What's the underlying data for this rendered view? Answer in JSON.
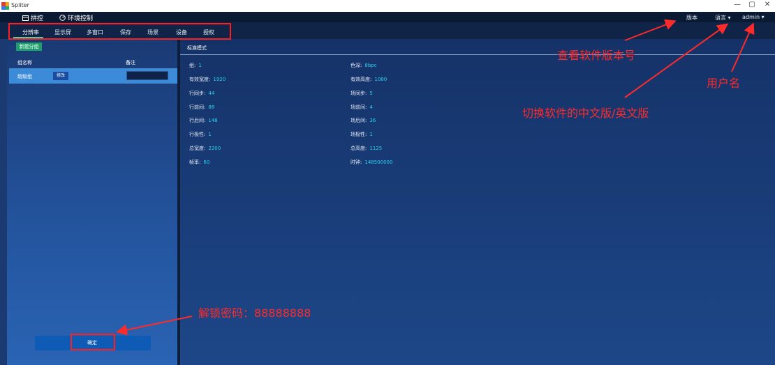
{
  "window": {
    "title": "Spliter",
    "min_glyph": "—",
    "max_glyph": "▢",
    "close_glyph": "✕"
  },
  "topnav": {
    "tabs": [
      {
        "label": "拼控",
        "icon": "window-icon"
      },
      {
        "label": "环境控制",
        "icon": "gauge-icon"
      }
    ],
    "version_label": "版本",
    "language_label": "语言",
    "user_label": "admin",
    "caret": "▾"
  },
  "subnav": {
    "items": [
      "分辨率",
      "显示屏",
      "多窗口",
      "保存",
      "场景",
      "设备",
      "授权"
    ],
    "active": "分辨率"
  },
  "left": {
    "new_group_label": "新建分组",
    "col_name": "组名称",
    "col_note": "备注",
    "row": {
      "name": "超级组",
      "edit_label": "修改",
      "note_value": ""
    },
    "confirm_label": "确定"
  },
  "main": {
    "mode_title": "标准模式",
    "params_left": [
      {
        "label": "组:",
        "value": "1"
      },
      {
        "label": "有效宽度:",
        "value": "1920"
      },
      {
        "label": "行同步:",
        "value": "44"
      },
      {
        "label": "行前间:",
        "value": "88"
      },
      {
        "label": "行后间:",
        "value": "148"
      },
      {
        "label": "行极性:",
        "value": "1"
      },
      {
        "label": "总宽度:",
        "value": "2200"
      },
      {
        "label": "帧率:",
        "value": "60"
      }
    ],
    "params_right": [
      {
        "label": "色深:",
        "value": "8bpc"
      },
      {
        "label": "有效高度:",
        "value": "1080"
      },
      {
        "label": "场同步:",
        "value": "5"
      },
      {
        "label": "场前间:",
        "value": "4"
      },
      {
        "label": "场后间:",
        "value": "36"
      },
      {
        "label": "场极性:",
        "value": "1"
      },
      {
        "label": "总高度:",
        "value": "1125"
      },
      {
        "label": "时钟:",
        "value": "148500000"
      }
    ]
  },
  "annotations": {
    "version": "查看软件版本号",
    "username": "用户名",
    "language": "切换软件的中文版/英文版",
    "unlock": "解锁密码：88888888"
  },
  "colors": {
    "annotation": "#ff2a2a",
    "value": "#29d3ef",
    "active_underline": "#4fd1a5"
  }
}
